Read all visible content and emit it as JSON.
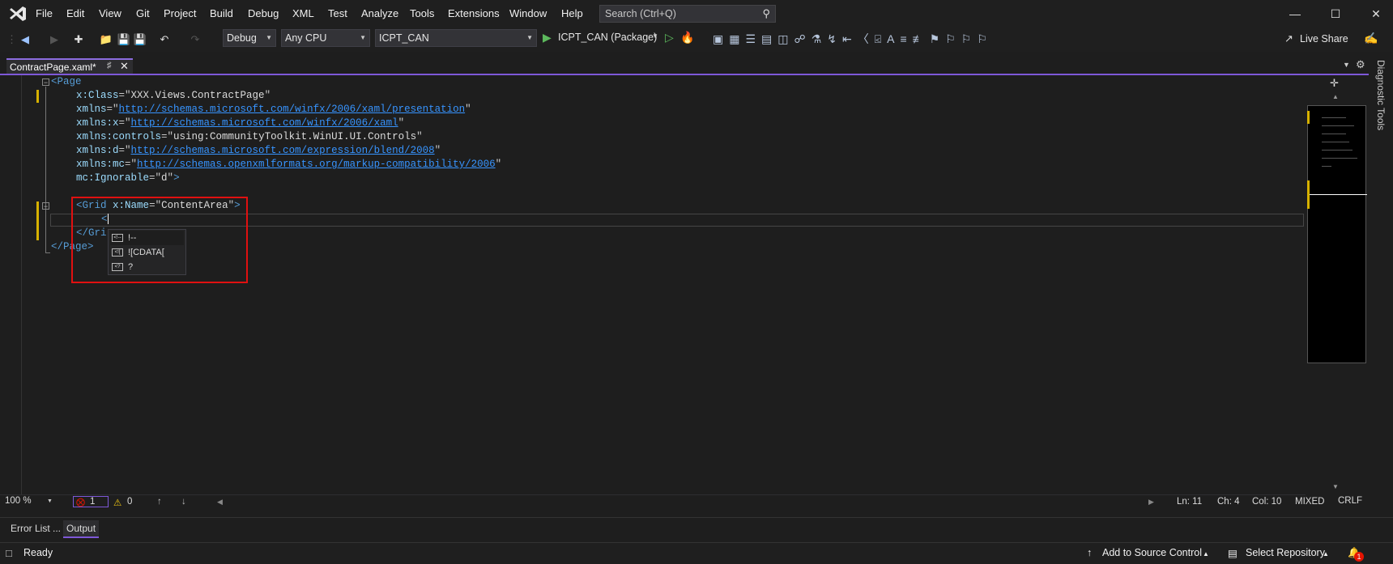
{
  "menu": {
    "items": [
      "File",
      "Edit",
      "View",
      "Git",
      "Project",
      "Build",
      "Debug",
      "XML",
      "Test",
      "Analyze",
      "Tools",
      "Extensions",
      "Window",
      "Help"
    ],
    "search_placeholder": "Search (Ctrl+Q)"
  },
  "toolbar": {
    "configuration": "Debug",
    "platform": "Any CPU",
    "startup_project": "ICPT_CAN",
    "run_target": "ICPT_CAN (Package)",
    "live_share": "Live Share"
  },
  "tabs": {
    "active_file": "ContractPage.xaml*"
  },
  "code": {
    "lines": [
      {
        "page_open": "<Page"
      },
      {
        "attr": "x:Class",
        "value": "XXX.Views.ContractPage"
      },
      {
        "attr": "xmlns",
        "value": "http://schemas.microsoft.com/winfx/2006/xaml/presentation"
      },
      {
        "attr": "xmlns:x",
        "value": "http://schemas.microsoft.com/winfx/2006/xaml"
      },
      {
        "attr": "xmlns:controls",
        "value": "using:CommunityToolkit.WinUI.UI.Controls"
      },
      {
        "attr": "xmlns:d",
        "value": "http://schemas.microsoft.com/expression/blend/2008"
      },
      {
        "attr": "xmlns:mc",
        "value": "http://schemas.openxmlformats.org/markup-compatibility/2006"
      },
      {
        "attr": "mc:Ignorable",
        "value": "d"
      }
    ],
    "grid_tag": "Grid",
    "grid_attr": "x:Name",
    "grid_value": "ContentArea",
    "typing": "<",
    "grid_close": "</Gri",
    "page_close": "</Page>"
  },
  "completion": {
    "items": [
      {
        "icon": "<!--",
        "label": "!--"
      },
      {
        "icon": "<![",
        "label": "![CDATA["
      },
      {
        "icon": "<?",
        "label": "?"
      }
    ]
  },
  "side_tool": {
    "diagnostic_tools": "Diagnostic Tools"
  },
  "editor_status": {
    "zoom": "100 %",
    "errors": "1",
    "warnings": "0",
    "line": "Ln: 11",
    "char": "Ch: 4",
    "col": "Col: 10",
    "whitespace": "MIXED",
    "line_endings": "CRLF"
  },
  "panel": {
    "tabs": [
      "Error List ...",
      "Output"
    ],
    "active": "Output"
  },
  "status": {
    "ready": "Ready",
    "source_control": "Add to Source Control",
    "repository": "Select Repository",
    "notifications": "1"
  },
  "colors": {
    "accent": "#7e58d8",
    "highlight_box": "#e01010",
    "error": "#e51400",
    "warning": "#f2c811"
  }
}
